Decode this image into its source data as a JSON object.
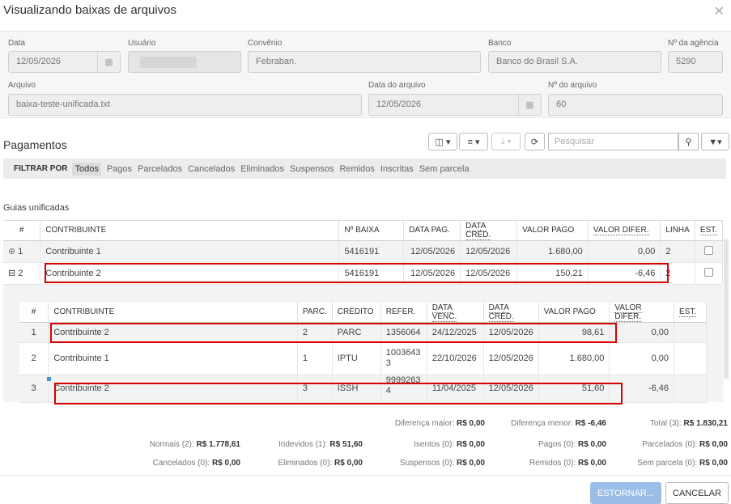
{
  "title": "Visualizando baixas de arquivos",
  "close_icon": "close-icon",
  "form": {
    "data_label": "Data",
    "data_value": "12/05/2026",
    "usuario_label": "Usuário",
    "usuario_value": "",
    "convenio_label": "Convênio",
    "convenio_value": "Febraban.",
    "banco_label": "Banco",
    "banco_value": "Banco do Brasil S.A.",
    "agencia_label": "Nº da agência",
    "agencia_value": "5290",
    "arquivo_label": "Arquivo",
    "arquivo_value": "baixa-teste-unificada.txt",
    "data_arquivo_label": "Data do arquivo",
    "data_arquivo_value": "12/05/2026",
    "num_arquivo_label": "Nº do arquivo",
    "num_arquivo_value": "60"
  },
  "pagamentos": {
    "title": "Pagamentos",
    "search_placeholder": "Pesquisar",
    "filter_label": "FILTRAR POR",
    "filters": [
      "Todos",
      "Pagos",
      "Parcelados",
      "Cancelados",
      "Eliminados",
      "Suspensos",
      "Remidos",
      "Inscritas",
      "Sem parcela"
    ],
    "active_filter": "Todos"
  },
  "guias_label": "Guias unificadas",
  "main_table": {
    "headers": [
      "#",
      "CONTRIBUINTE",
      "Nº BAIXA",
      "DATA PAG.",
      "DATA CRÉD.",
      "VALOR PAGO",
      "VALOR DIFER.",
      "LINHA",
      "EST."
    ],
    "rows": [
      {
        "num": "1",
        "contribuinte": "Contribuinte 1",
        "baixa": "5416191",
        "data_pag": "12/05/2026",
        "data_cred": "12/05/2026",
        "valor_pago": "1.680,00",
        "valor_difer": "0,00",
        "linha": "2"
      },
      {
        "num": "2",
        "contribuinte": "Contribuinte 2",
        "baixa": "5416191",
        "data_pag": "12/05/2026",
        "data_cred": "12/05/2026",
        "valor_pago": "150,21",
        "valor_difer": "-6,46",
        "linha": "2"
      }
    ]
  },
  "sub_table": {
    "headers": [
      "#",
      "CONTRIBUINTE",
      "PARC.",
      "CRÉDITO",
      "REFER.",
      "DATA VENC.",
      "DATA CRÉD.",
      "VALOR PAGO",
      "VALOR DIFER.",
      "EST."
    ],
    "rows": [
      {
        "num": "1",
        "contribuinte": "Contribuinte 2",
        "parc": "2",
        "credito": "PARC",
        "refer_a": "1356064",
        "refer_b": "",
        "data_venc": "24/12/2025",
        "data_cred": "12/05/2026",
        "valor_pago": "98,61",
        "valor_difer": "0,00"
      },
      {
        "num": "2",
        "contribuinte": "Contribuinte 1",
        "parc": "1",
        "credito": "IPTU",
        "refer_a": "1003643",
        "refer_b": "3",
        "data_venc": "22/10/2026",
        "data_cred": "12/05/2026",
        "valor_pago": "1.680,00",
        "valor_difer": "0,00"
      },
      {
        "num": "3",
        "contribuinte": "Contribuinte 2",
        "parc": "3",
        "credito": "ISSH",
        "refer_a": "9999263",
        "refer_b": "4",
        "data_venc": "11/04/2025",
        "data_cred": "12/05/2026",
        "valor_pago": "51,60",
        "valor_difer": "-6,46"
      }
    ]
  },
  "summary": {
    "dif_maior_label": "Diferença maior:",
    "dif_maior_value": "R$ 0,00",
    "dif_menor_label": "Diferença menor:",
    "dif_menor_value": "R$ -6,46",
    "total_label": "Total (3):",
    "total_value": "R$ 1.830,21",
    "normais_label": "Normais (2):",
    "normais_value": "R$ 1.778,61",
    "indevidos_label": "Indevidos (1):",
    "indevidos_value": "R$ 51,60",
    "isentos_label": "Isentos (0):",
    "isentos_value": "R$ 0,00",
    "pagos_label": "Pagos (0):",
    "pagos_value": "R$ 0,00",
    "parcelados_label": "Parcelados (0):",
    "parcelados_value": "R$ 0,00",
    "cancelados_label": "Cancelados (0):",
    "cancelados_value": "R$ 0,00",
    "eliminados_label": "Eliminados (0):",
    "eliminados_value": "R$ 0,00",
    "suspensos_label": "Suspensos (0):",
    "suspensos_value": "R$ 0,00",
    "remidos_label": "Remidos (0):",
    "remidos_value": "R$ 0,00",
    "sem_parcela_label": "Sem parcela (0):",
    "sem_parcela_value": "R$ 0,00"
  },
  "buttons": {
    "estornar": "ESTORNAR...",
    "cancelar": "CANCELAR"
  },
  "colors": {
    "highlight": "#d90000",
    "primary_disabled": "#9bbde6"
  }
}
